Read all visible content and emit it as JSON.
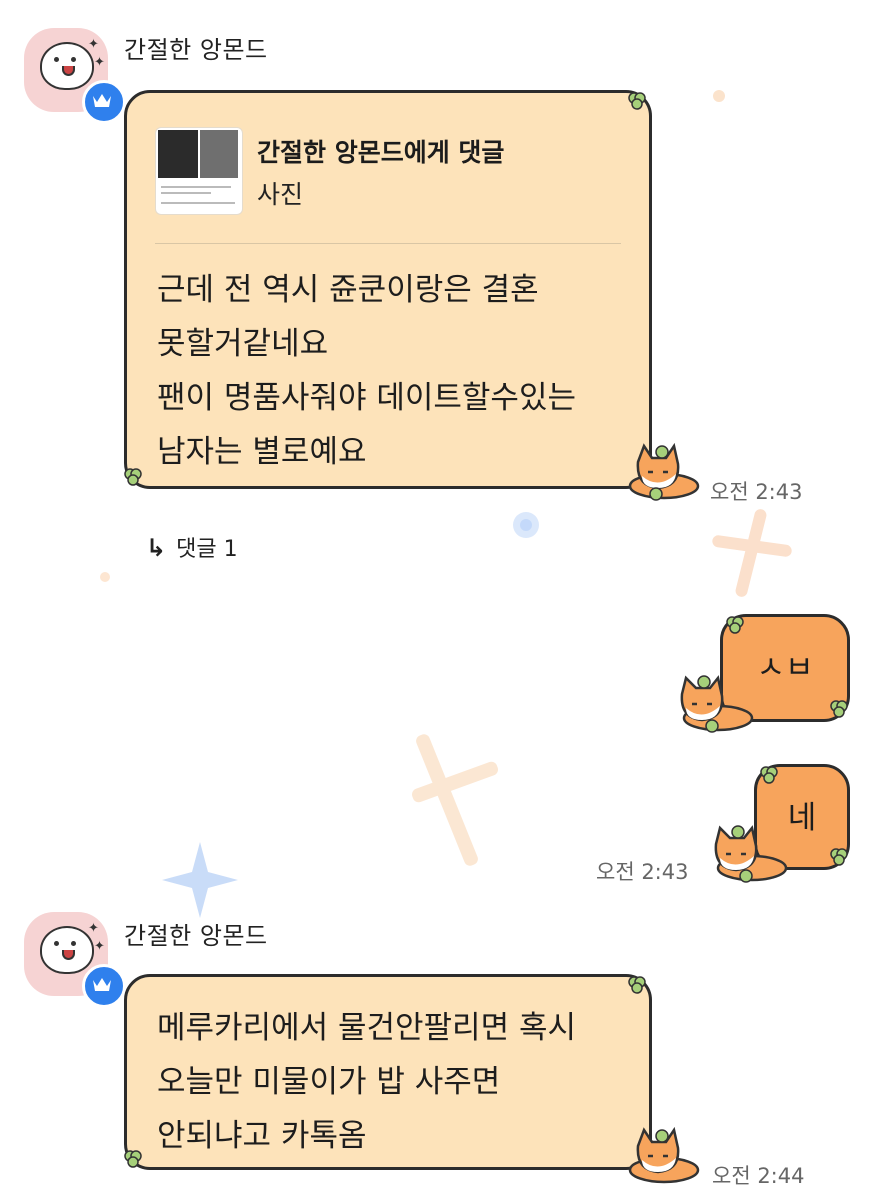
{
  "messages": [
    {
      "sender": "간절한 앙몬드",
      "quote": {
        "title": "간절한 앙몬드에게 댓글",
        "type": "사진"
      },
      "text": "근데 전 역시 쥰쿤이랑은 결혼\n못할거같네요\n팬이 명품사줘야 데이트할수있는\n남자는 별로예요",
      "time": "오전 2:43"
    },
    {
      "reply_label": "댓글 1"
    },
    {
      "outgoing_text": "ㅅㅂ"
    },
    {
      "outgoing_text": "네",
      "time": "오전 2:43"
    },
    {
      "sender": "간절한 앙몬드",
      "text": "메루카리에서 물건안팔리면 혹시\n오늘만 미물이가 밥 사주면\n안되냐고 카톡옴",
      "time": "오전 2:44"
    }
  ],
  "icons": {
    "crown": "crown-icon",
    "reply_arrow": "reply-arrow-icon",
    "fox": "fox-sticker-icon",
    "leaf": "clover-leaf-icon"
  },
  "colors": {
    "incoming_bubble": "#fde3ba",
    "outgoing_bubble": "#f7a45c",
    "badge": "#2f80ed",
    "avatar_bg": "#f6d3d3"
  }
}
